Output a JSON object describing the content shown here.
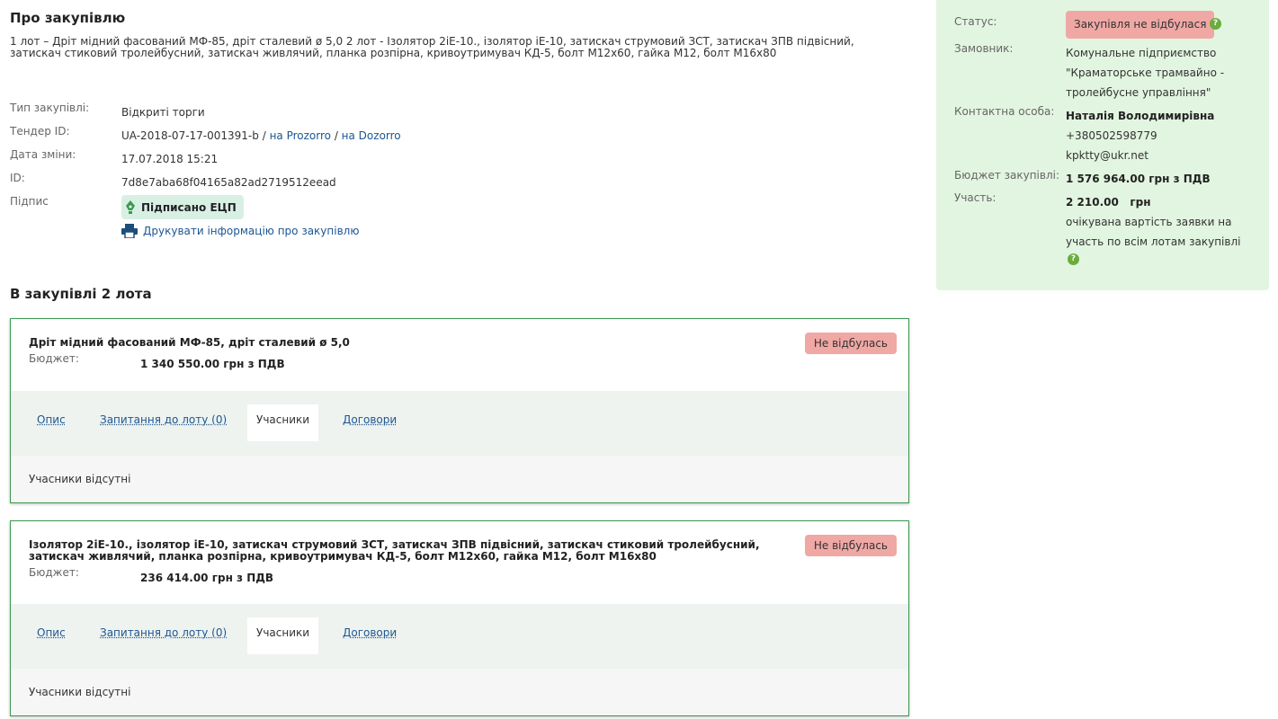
{
  "page": {
    "title": "Про закупівлю",
    "description": "1 лот – Дріт мідний фасований МФ-85, дріт сталевий ø 5,0 2 лот - Ізолятор 2іЕ-10., ізолятор іЕ-10, затискач струмовий ЗСТ, затискач ЗПВ підвісний, затискач стиковий тролейбусний, затискач живлячий, планка розпірна, кривоутримувач КД-5, болт М12х60, гайка М12, болт М16х80"
  },
  "info": {
    "type_label": "Тип закупівлі:",
    "type_value": "Відкриті торги",
    "tender_label": "Тендер ID:",
    "tender_id": "UA-2018-07-17-001391-b",
    "tender_sep1": " / ",
    "tender_link1": "на Prozorro",
    "tender_sep2": " / ",
    "tender_link2": "на Dozorro",
    "date_label": "Дата зміни:",
    "date_value": "17.07.2018 15:21",
    "id_label": "ID:",
    "id_value": "7d8e7aba68f04165a82ad2719512eead",
    "sign_label": "Підпис",
    "sign_badge": "Підписано ЕЦП",
    "print_link": "Друкувати інформацію про закупівлю"
  },
  "lots_title": "В закупівлі 2 лота",
  "lots": [
    {
      "title": "Дріт мідний фасований МФ-85, дріт сталевий ø 5,0",
      "budget_label": "Бюджет:",
      "budget_value": "1 340 550.00 грн з ПДВ",
      "status": "Не відбулась",
      "tabs": [
        "Опис",
        "Запитання до лоту (0)",
        "Учасники",
        "Договори"
      ],
      "empty_text": "Учасники відсутні"
    },
    {
      "title": "Ізолятор 2іЕ-10., ізолятор іЕ-10, затискач струмовий ЗСТ, затискач ЗПВ підвісний, затискач стиковий тролейбусний, затискач живлячий, планка розпірна, кривоутримувач КД-5, болт М12х60, гайка М12, болт М16х80",
      "budget_label": "Бюджет:",
      "budget_value": "236 414.00 грн з ПДВ",
      "status": "Не відбулась",
      "tabs": [
        "Опис",
        "Запитання до лоту (0)",
        "Учасники",
        "Договори"
      ],
      "empty_text": "Учасники відсутні"
    }
  ],
  "sidebar": {
    "status_label": "Статус:",
    "status_value": "Закупівля не відбулася",
    "customer_label": "Замовник:",
    "customer_line1": "Комунальне підприємство",
    "customer_line2": "\"Краматорське трамвайно -",
    "customer_line3": "тролейбусне управління\"",
    "contact_label": "Контактна особа:",
    "contact_name": "Наталія Володимирівна",
    "contact_phone": "+380502598779",
    "contact_email": "kpktty@ukr.net",
    "budget_label": "Бюджет закупівлі:",
    "budget_value": "1 576 964.00 грн з ПДВ",
    "participation_label": "Участь:",
    "participation_value": "2 210.00   грн",
    "participation_note1": "очікувана вартість заявки на",
    "participation_note2": "участь по всім лотам закупівлі",
    "help_glyph": "?"
  },
  "colors": {
    "accent_green": "#3c9a4f",
    "status_red": "#f0a8a5",
    "sidebar_bg": "#e2f5e0",
    "link": "#1c5693"
  }
}
